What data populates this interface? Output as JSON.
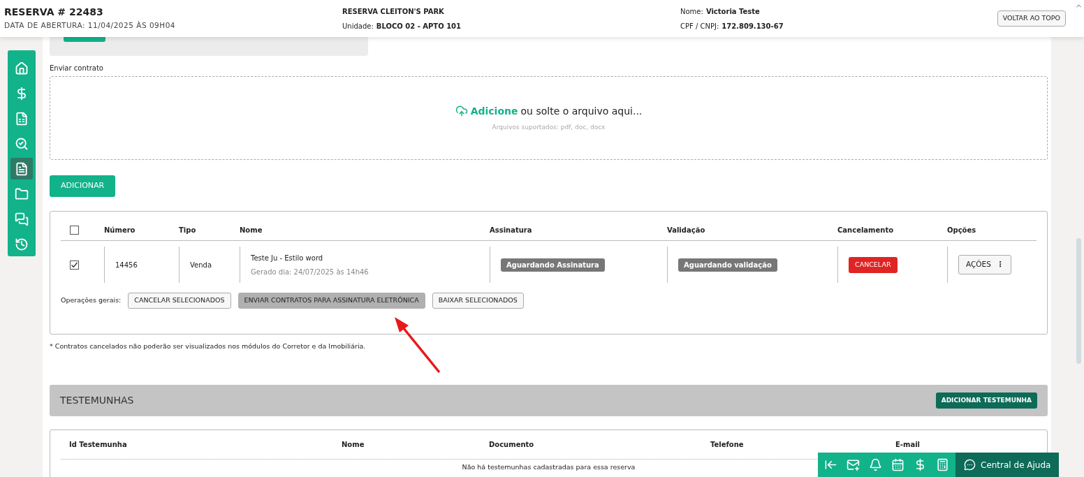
{
  "header": {
    "title": "RESERVA # 22483",
    "opened": "DATA DE ABERTURA: 11/04/2025 ÀS 09H04",
    "project": "RESERVA CLEITON'S PARK",
    "unit_label": "Unidade:",
    "unit": "BLOCO 02 - APTO 101",
    "name_label": "Nome:",
    "name": "Victoria Teste",
    "doc_label": "CPF / CNPJ:",
    "doc": "172.809.130-67",
    "top_button": "VOLTAR AO TOPO"
  },
  "sidebar": {
    "items": [
      {
        "kind": "home",
        "selected": false
      },
      {
        "kind": "money",
        "selected": false
      },
      {
        "kind": "invoice",
        "selected": false
      },
      {
        "kind": "search",
        "selected": false
      },
      {
        "kind": "document",
        "selected": true
      },
      {
        "kind": "folder",
        "selected": false
      },
      {
        "kind": "chat",
        "selected": false
      },
      {
        "kind": "history",
        "selected": false
      }
    ]
  },
  "upload": {
    "label": "Enviar contrato",
    "link": "Adicione",
    "text": "ou solte o arquivo aqui...",
    "hint": "Arquivos suportados: pdf, doc, docx",
    "button": "ADICIONAR"
  },
  "contracts": {
    "header_checked": false,
    "columns": [
      "Número",
      "Tipo",
      "Nome",
      "Assinatura",
      "Validação",
      "Cancelamento",
      "Opções"
    ],
    "rows": [
      {
        "checked": true,
        "number": "14456",
        "type": "Venda",
        "name": "Teste Ju - Estilo word",
        "generated": "Gerado dia: 24/07/2025 às 14h46",
        "signature": "Aguardando Assinatura",
        "validation": "Aguardando validação",
        "cancel": "CANCELAR",
        "actions": "AÇÕES",
        "actions_icon": "⋮"
      }
    ],
    "operations_label": "Operações gerais:",
    "operations": [
      {
        "label": "CANCELAR SELECIONADOS",
        "disabled": false
      },
      {
        "label": "ENVIAR CONTRATOS PARA ASSINATURA ELETRÔNICA",
        "disabled": true
      },
      {
        "label": "BAIXAR SELECIONADOS",
        "disabled": false
      }
    ]
  },
  "footnote": "* Contratos cancelados não poderão ser visualizados nos módulos do Corretor e da Imobiliária.",
  "witnesses": {
    "title": "TESTEMUNHAS",
    "add_button": "ADICIONAR TESTEMUNHA",
    "columns": [
      "Id Testemunha",
      "Nome",
      "Documento",
      "Telefone",
      "E-mail"
    ],
    "empty": "Não há testemunhas cadastradas para essa reserva"
  },
  "help_bar": {
    "icons": [
      {
        "kind": "collapse"
      },
      {
        "kind": "mail"
      },
      {
        "kind": "bell"
      },
      {
        "kind": "calendar"
      },
      {
        "kind": "money"
      },
      {
        "kind": "calculator"
      }
    ],
    "label": "Central de Ajuda"
  }
}
